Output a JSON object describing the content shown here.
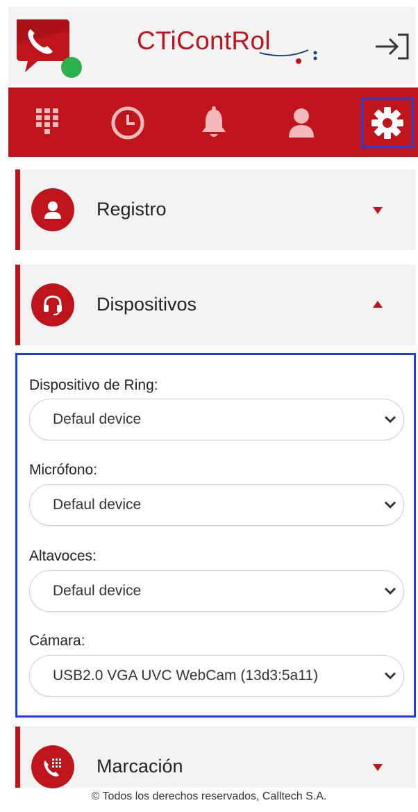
{
  "header": {
    "brand": "CTiContRol",
    "logout_icon": "logout-icon",
    "logo_icon": "phone-chat-logo"
  },
  "navbar": {
    "items": [
      {
        "icon": "dialpad-icon",
        "active": false
      },
      {
        "icon": "history-clock-icon",
        "active": false
      },
      {
        "icon": "bell-icon",
        "active": false
      },
      {
        "icon": "user-icon",
        "active": false
      },
      {
        "icon": "gear-icon",
        "active": true
      }
    ]
  },
  "sections": {
    "registro": {
      "title": "Registro",
      "caret": "down"
    },
    "dispositivos": {
      "title": "Dispositivos",
      "caret": "up"
    },
    "marcacion": {
      "title": "Marcación",
      "caret": "down"
    }
  },
  "devices": {
    "ring_label": "Dispositivo de Ring:",
    "ring_value": "Defaul device",
    "mic_label": "Micrófono:",
    "mic_value": "Defaul device",
    "speakers_label": "Altavoces:",
    "speakers_value": "Defaul device",
    "camera_label": "Cámara:",
    "camera_value": "USB2.0 VGA UVC WebCam (13d3:5a11)"
  },
  "footer": {
    "text": "© Todos los derechos reservados, Calltech S.A."
  },
  "colors": {
    "brand_red": "#c0141c",
    "highlight_blue": "#1c3fe0",
    "status_green": "#2bb24c"
  }
}
